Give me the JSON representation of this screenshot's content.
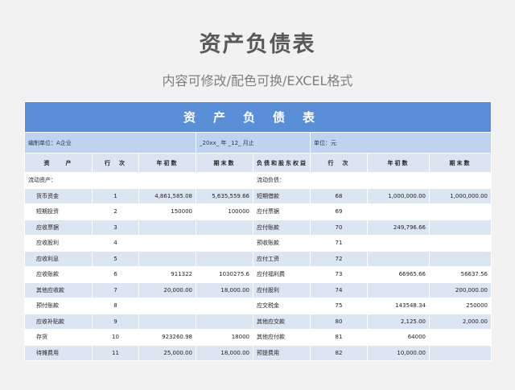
{
  "page": {
    "title": "资产负债表",
    "subtitle": "内容可修改/配色可换/EXCEL格式"
  },
  "sheet": {
    "banner": "资产负债表",
    "info": {
      "unit": "编制单位：A企业",
      "period": "_20xx_ 年 _12_ 月止",
      "currency": "单位：元"
    },
    "headers": [
      "资　　产",
      "行　次",
      "年初数",
      "期末数",
      "负债和股东权益",
      "行　次",
      "年初数",
      "期末数"
    ],
    "section_left": "流动资产：",
    "section_right": "流动负债：",
    "rows": [
      {
        "la": "货币资金",
        "ln": "1",
        "lb": "4,861,585.08",
        "le": "5,635,559.66",
        "ra": "短期借款",
        "rn": "68",
        "rb": "1,000,000.00",
        "re": "1,000,000.00"
      },
      {
        "la": "短期投资",
        "ln": "2",
        "lb": "150000",
        "le": "100000",
        "ra": "应付票据",
        "rn": "69",
        "rb": "",
        "re": ""
      },
      {
        "la": "应收票据",
        "ln": "3",
        "lb": "",
        "le": "",
        "ra": "应付账款",
        "rn": "70",
        "rb": "249,796.66",
        "re": ""
      },
      {
        "la": "应收股利",
        "ln": "4",
        "lb": "",
        "le": "",
        "ra": "预收账款",
        "rn": "71",
        "rb": "",
        "re": ""
      },
      {
        "la": "应收利息",
        "ln": "5",
        "lb": "",
        "le": "",
        "ra": "应付工资",
        "rn": "72",
        "rb": "",
        "re": ""
      },
      {
        "la": "应收账款",
        "ln": "6",
        "lb": "911322",
        "le": "1030275.6",
        "ra": "应付福利费",
        "rn": "73",
        "rb": "66965.66",
        "re": "56637.56"
      },
      {
        "la": "其他应收款",
        "ln": "7",
        "lb": "20,000.00",
        "le": "18,000.00",
        "ra": "应付股利",
        "rn": "74",
        "rb": "",
        "re": "200,000.00"
      },
      {
        "la": "预付账款",
        "ln": "8",
        "lb": "",
        "le": "",
        "ra": "应交税金",
        "rn": "75",
        "rb": "143548.34",
        "re": "250000"
      },
      {
        "la": "应收补贴款",
        "ln": "9",
        "lb": "",
        "le": "",
        "ra": "其他应交款",
        "rn": "80",
        "rb": "2,125.00",
        "re": "2,000.00"
      },
      {
        "la": "存货",
        "ln": "10",
        "lb": "923260.98",
        "le": "18000",
        "ra": "其他应付款",
        "rn": "81",
        "rb": "64000",
        "re": ""
      },
      {
        "la": "待摊费用",
        "ln": "11",
        "lb": "25,000.00",
        "le": "18,000.00",
        "ra": "预提费用",
        "rn": "82",
        "rb": "10,000.00",
        "re": ""
      }
    ]
  }
}
